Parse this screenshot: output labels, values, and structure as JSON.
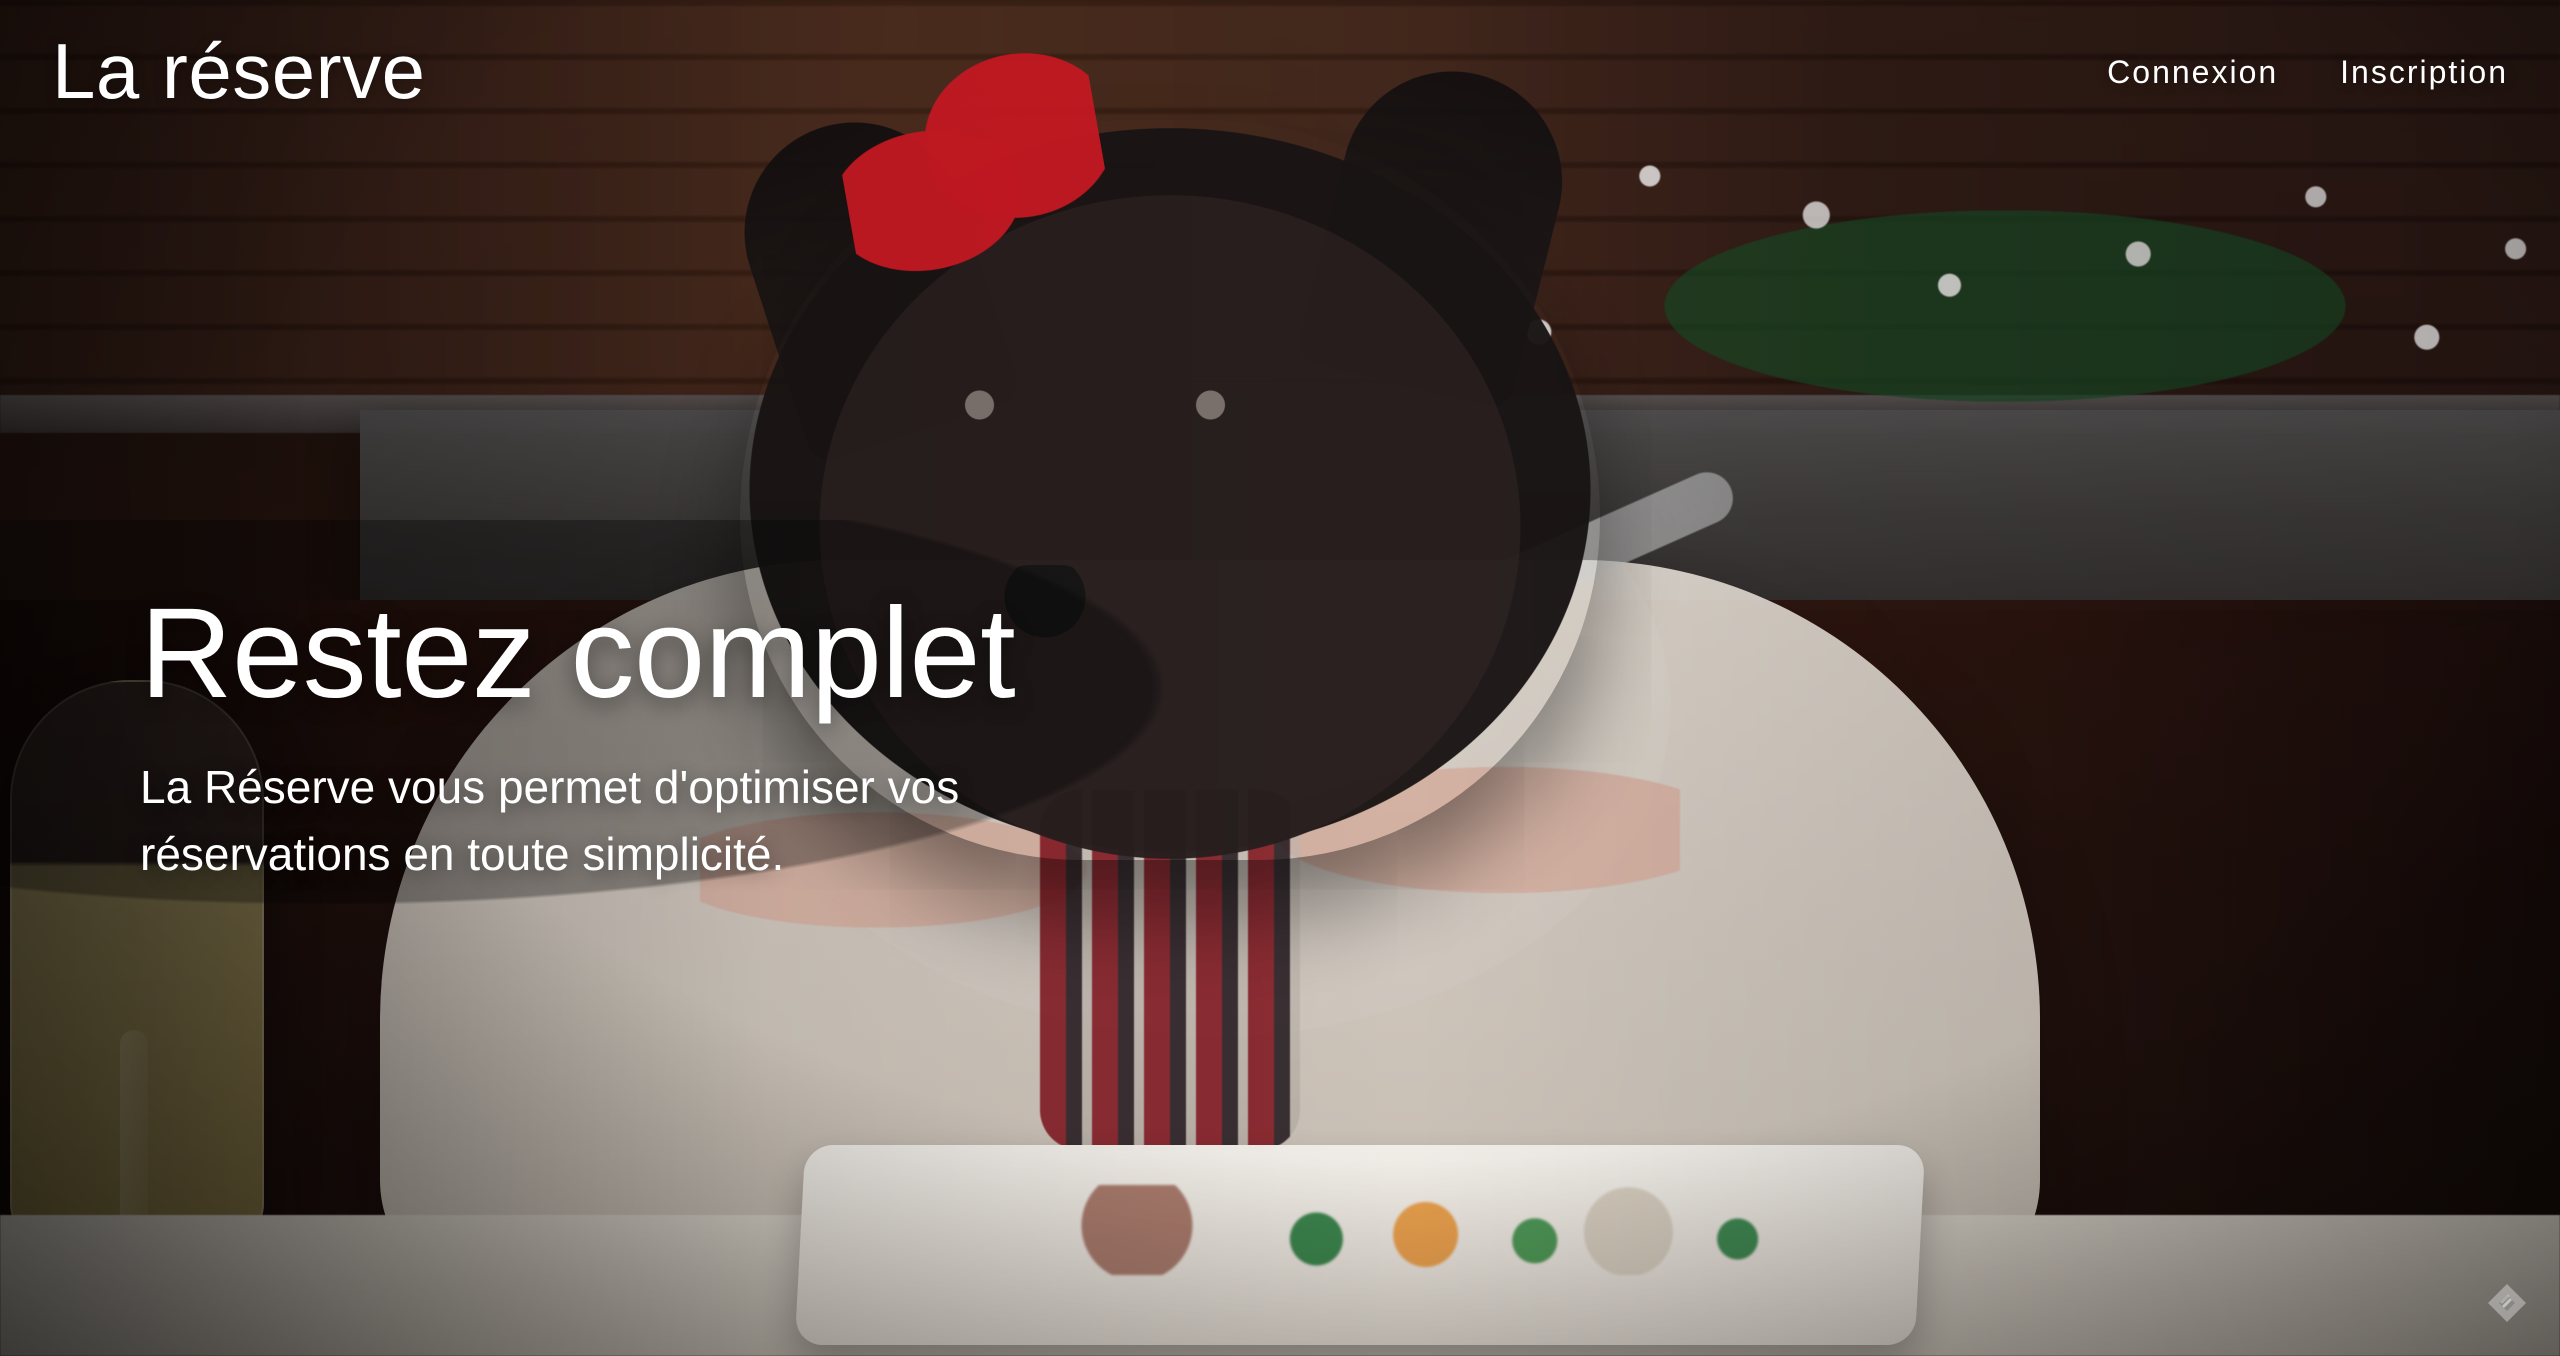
{
  "nav": {
    "logo": "La réserve",
    "links": [
      {
        "label": "Connexion"
      },
      {
        "label": "Inscription"
      }
    ]
  },
  "hero": {
    "title": "Restez complet",
    "subtitle": "La Réserve vous permet d'optimiser vos réservations en toute simplicité."
  },
  "icons": {
    "corner": "tag-icon"
  },
  "colors": {
    "text": "#ffffff"
  }
}
